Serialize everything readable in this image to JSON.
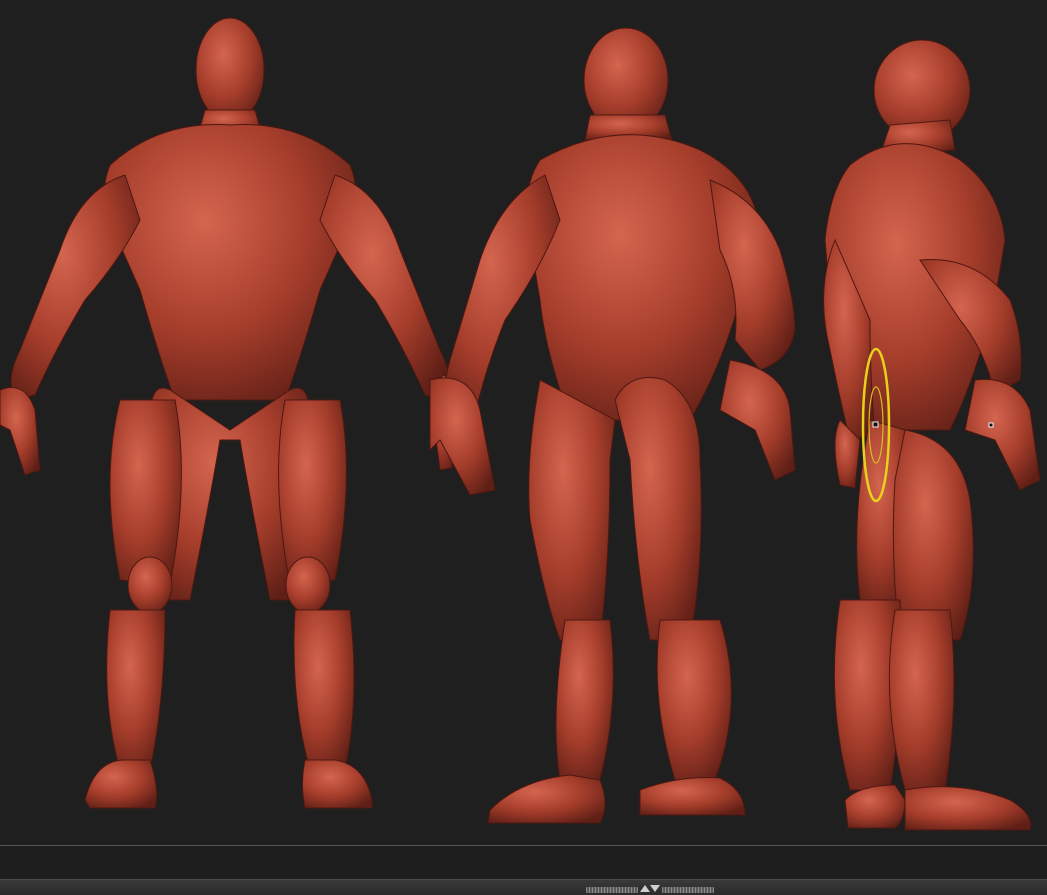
{
  "viewport": {
    "figures": [
      "front-view",
      "back-view",
      "side-view"
    ],
    "material_color": "#a53d2b",
    "background_color": "#1f1f1f"
  },
  "brush_cursor": {
    "outer_color": "#e6d21a",
    "inner_color": "#d6c01a"
  },
  "bottom_tray": {
    "toggle_icon": "tray-toggle-arrows-icon"
  }
}
